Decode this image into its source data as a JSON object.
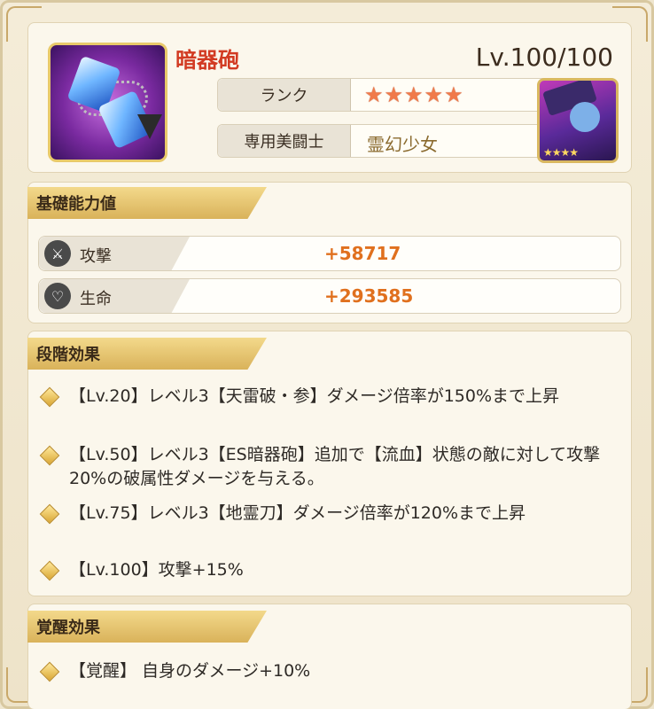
{
  "item": {
    "name": "暗器砲",
    "level": "Lv.100/100",
    "rank_label": "ランク",
    "rank_stars": 5,
    "fighter_label": "専用美闘士",
    "fighter_name": "霊幻少女"
  },
  "base_stats": {
    "title": "基礎能力値",
    "attack": {
      "label": "攻撃",
      "value": "+58717",
      "icon": "swords-icon"
    },
    "life": {
      "label": "生命",
      "value": "+293585",
      "icon": "heart-icon"
    }
  },
  "stage_effects": {
    "title": "段階効果",
    "items": [
      "【Lv.20】レベル3【天雷破・参】ダメージ倍率が150%まで上昇",
      "【Lv.50】レベル3【ES暗器砲】追加で【流血】状態の敵に対して攻撃20%の破属性ダメージを与える。",
      "【Lv.75】レベル3【地霊刀】ダメージ倍率が120%まで上昇",
      "【Lv.100】攻撃+15%"
    ]
  },
  "awakening_effects": {
    "title": "覚醒効果",
    "items": [
      "【覚醒】 自身のダメージ+10%"
    ]
  },
  "colors": {
    "accent_red": "#d23a22",
    "value_orange": "#e0701e",
    "ribbon_gold": "#d9b25a"
  }
}
